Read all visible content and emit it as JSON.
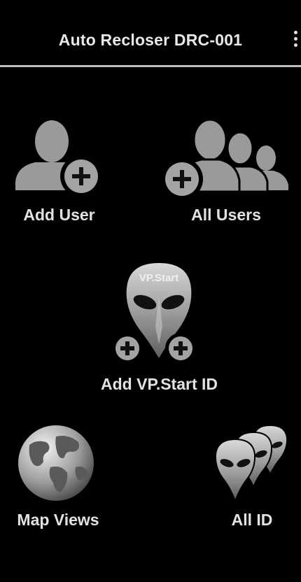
{
  "app_bar": {
    "title": "Auto Recloser DRC-001",
    "overflow_icon": "more-vert-icon"
  },
  "menu": [
    {
      "id": "add-user",
      "label": "Add User",
      "icon": "add-user-icon"
    },
    {
      "id": "all-users",
      "label": "All Users",
      "icon": "all-users-icon"
    },
    {
      "id": "add-vpstart-id",
      "label": "Add VP.Start ID",
      "icon": "vpstart-alien-add-icon",
      "icon_text": "VP.Start"
    },
    {
      "id": "map-views",
      "label": "Map Views",
      "icon": "globe-icon"
    },
    {
      "id": "all-id",
      "label": "All ID",
      "icon": "vpstart-alien-stack-icon"
    }
  ],
  "colors": {
    "background": "#000000",
    "icon_gray": "#9a9a9a",
    "text": "#e6e6e6",
    "divider": "#bdbdbd"
  }
}
